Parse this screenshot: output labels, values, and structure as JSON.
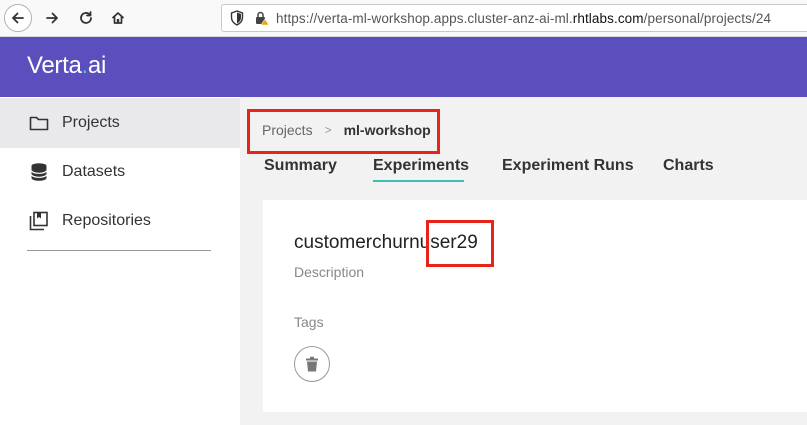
{
  "browser": {
    "url_prefix": "https://verta-ml-workshop.apps.cluster-anz-ai-ml.",
    "url_domain": "rhtlabs.com",
    "url_suffix": "/personal/projects/24"
  },
  "app": {
    "logo_main": "Verta",
    "logo_dot": ".",
    "logo_tail": "ai"
  },
  "sidebar": {
    "items": [
      {
        "label": "Projects",
        "icon": "folder-icon",
        "active": true
      },
      {
        "label": "Datasets",
        "icon": "database-icon",
        "active": false
      },
      {
        "label": "Repositories",
        "icon": "repository-icon",
        "active": false
      }
    ]
  },
  "breadcrumb": {
    "parent": "Projects",
    "separator": ">",
    "current": "ml-workshop"
  },
  "tabs": [
    {
      "label": "Summary"
    },
    {
      "label": "Experiments",
      "active": true
    },
    {
      "label": "Experiment Runs"
    },
    {
      "label": "Charts"
    }
  ],
  "experiment": {
    "name": "customerchurnuser29",
    "description_label": "Description",
    "tags_label": "Tags"
  },
  "colors": {
    "header": "#5b4fbe",
    "accent": "#3fbfb3",
    "highlight": "#e8241a"
  }
}
